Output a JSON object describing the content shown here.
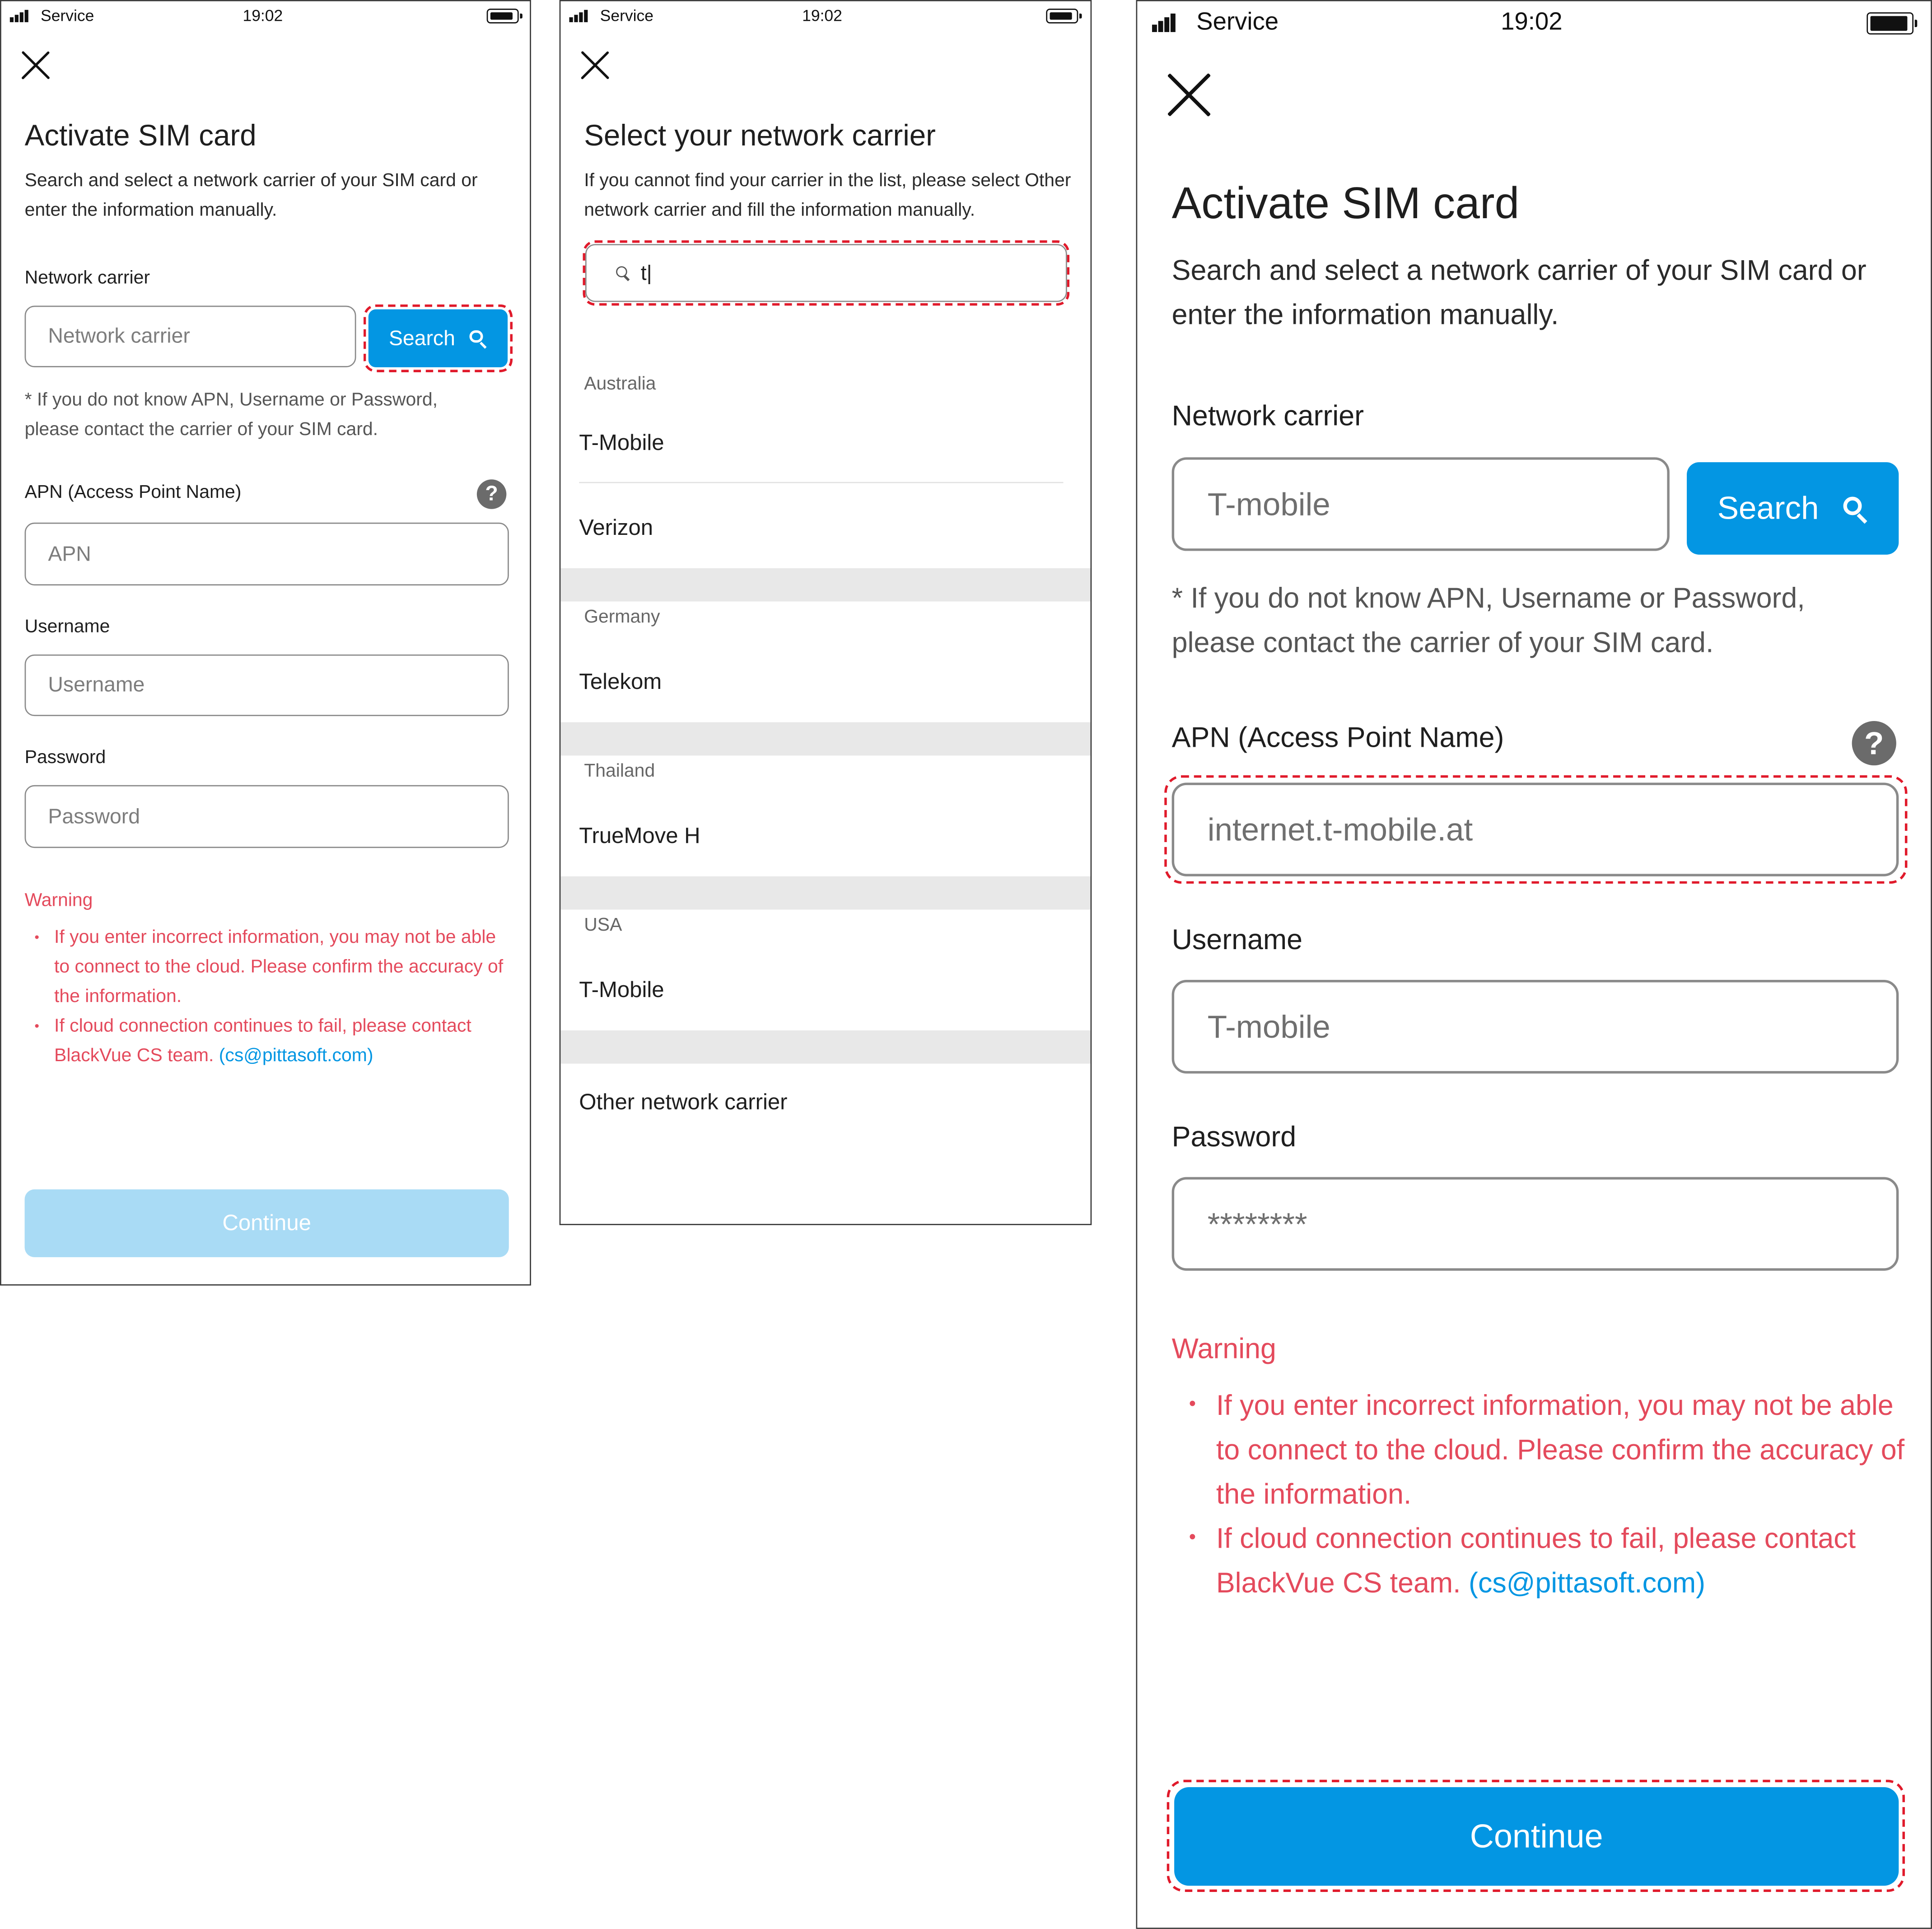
{
  "status_bar": {
    "carrier": "Service",
    "time": "19:02"
  },
  "screen1": {
    "title": "Activate SIM card",
    "description": "Search and select a network carrier of your SIM card or enter the information manually.",
    "network_carrier_label": "Network carrier",
    "network_carrier_placeholder": "Network carrier",
    "search_label": "Search",
    "hint": "* If you do not know APN, Username or Password, please contact the carrier of your SIM card.",
    "apn_label": "APN (Access Point Name)",
    "apn_placeholder": "APN",
    "help_glyph": "?",
    "username_label": "Username",
    "username_placeholder": "Username",
    "password_label": "Password",
    "password_placeholder": "Password",
    "warning_title": "Warning",
    "warning_1": "If you enter incorrect information, you may not be able to connect to the cloud. Please confirm the accuracy of the information.",
    "warning_2": "If cloud connection continues to fail, please contact BlackVue CS team.",
    "warning_email": "(cs@pittasoft.com)",
    "continue_label": "Continue",
    "continue_enabled": false
  },
  "screen2": {
    "title": "Select your network carrier",
    "description": "If you cannot find your carrier in the list, please select Other network carrier and fill the information manually.",
    "search_value": "t|",
    "groups": [
      {
        "country": "Australia",
        "carriers": [
          "T-Mobile",
          "Verizon"
        ]
      },
      {
        "country": "Germany",
        "carriers": [
          "Telekom"
        ]
      },
      {
        "country": "Thailand",
        "carriers": [
          "TrueMove H"
        ]
      },
      {
        "country": "USA",
        "carriers": [
          "T-Mobile"
        ]
      }
    ],
    "other_carrier": "Other network carrier"
  },
  "screen3": {
    "title": "Activate SIM card",
    "description": "Search and select a network carrier of your SIM card or enter the information manually.",
    "network_carrier_label": "Network carrier",
    "network_carrier_value": "T-mobile",
    "search_label": "Search",
    "hint": "* If you do not know APN, Username or Password, please contact the carrier of your SIM card.",
    "apn_label": "APN (Access Point Name)",
    "apn_value": "internet.t-mobile.at",
    "help_glyph": "?",
    "username_label": "Username",
    "username_value": "T-mobile",
    "password_label": "Password",
    "password_value": "********",
    "warning_title": "Warning",
    "warning_1": "If you enter incorrect information, you may not be able to connect to the cloud. Please confirm the accuracy of the information.",
    "warning_2": "If cloud connection continues to fail, please contact BlackVue CS team.",
    "warning_email": "(cs@pittasoft.com)",
    "continue_label": "Continue",
    "continue_enabled": true
  },
  "colors": {
    "accent": "#0396E3",
    "accent_disabled": "#A9DBF5",
    "warning": "#E44A5C",
    "highlight": "#E01A2B"
  },
  "icons": [
    "signal-icon",
    "battery-icon",
    "close-icon",
    "search-icon",
    "help-icon"
  ]
}
